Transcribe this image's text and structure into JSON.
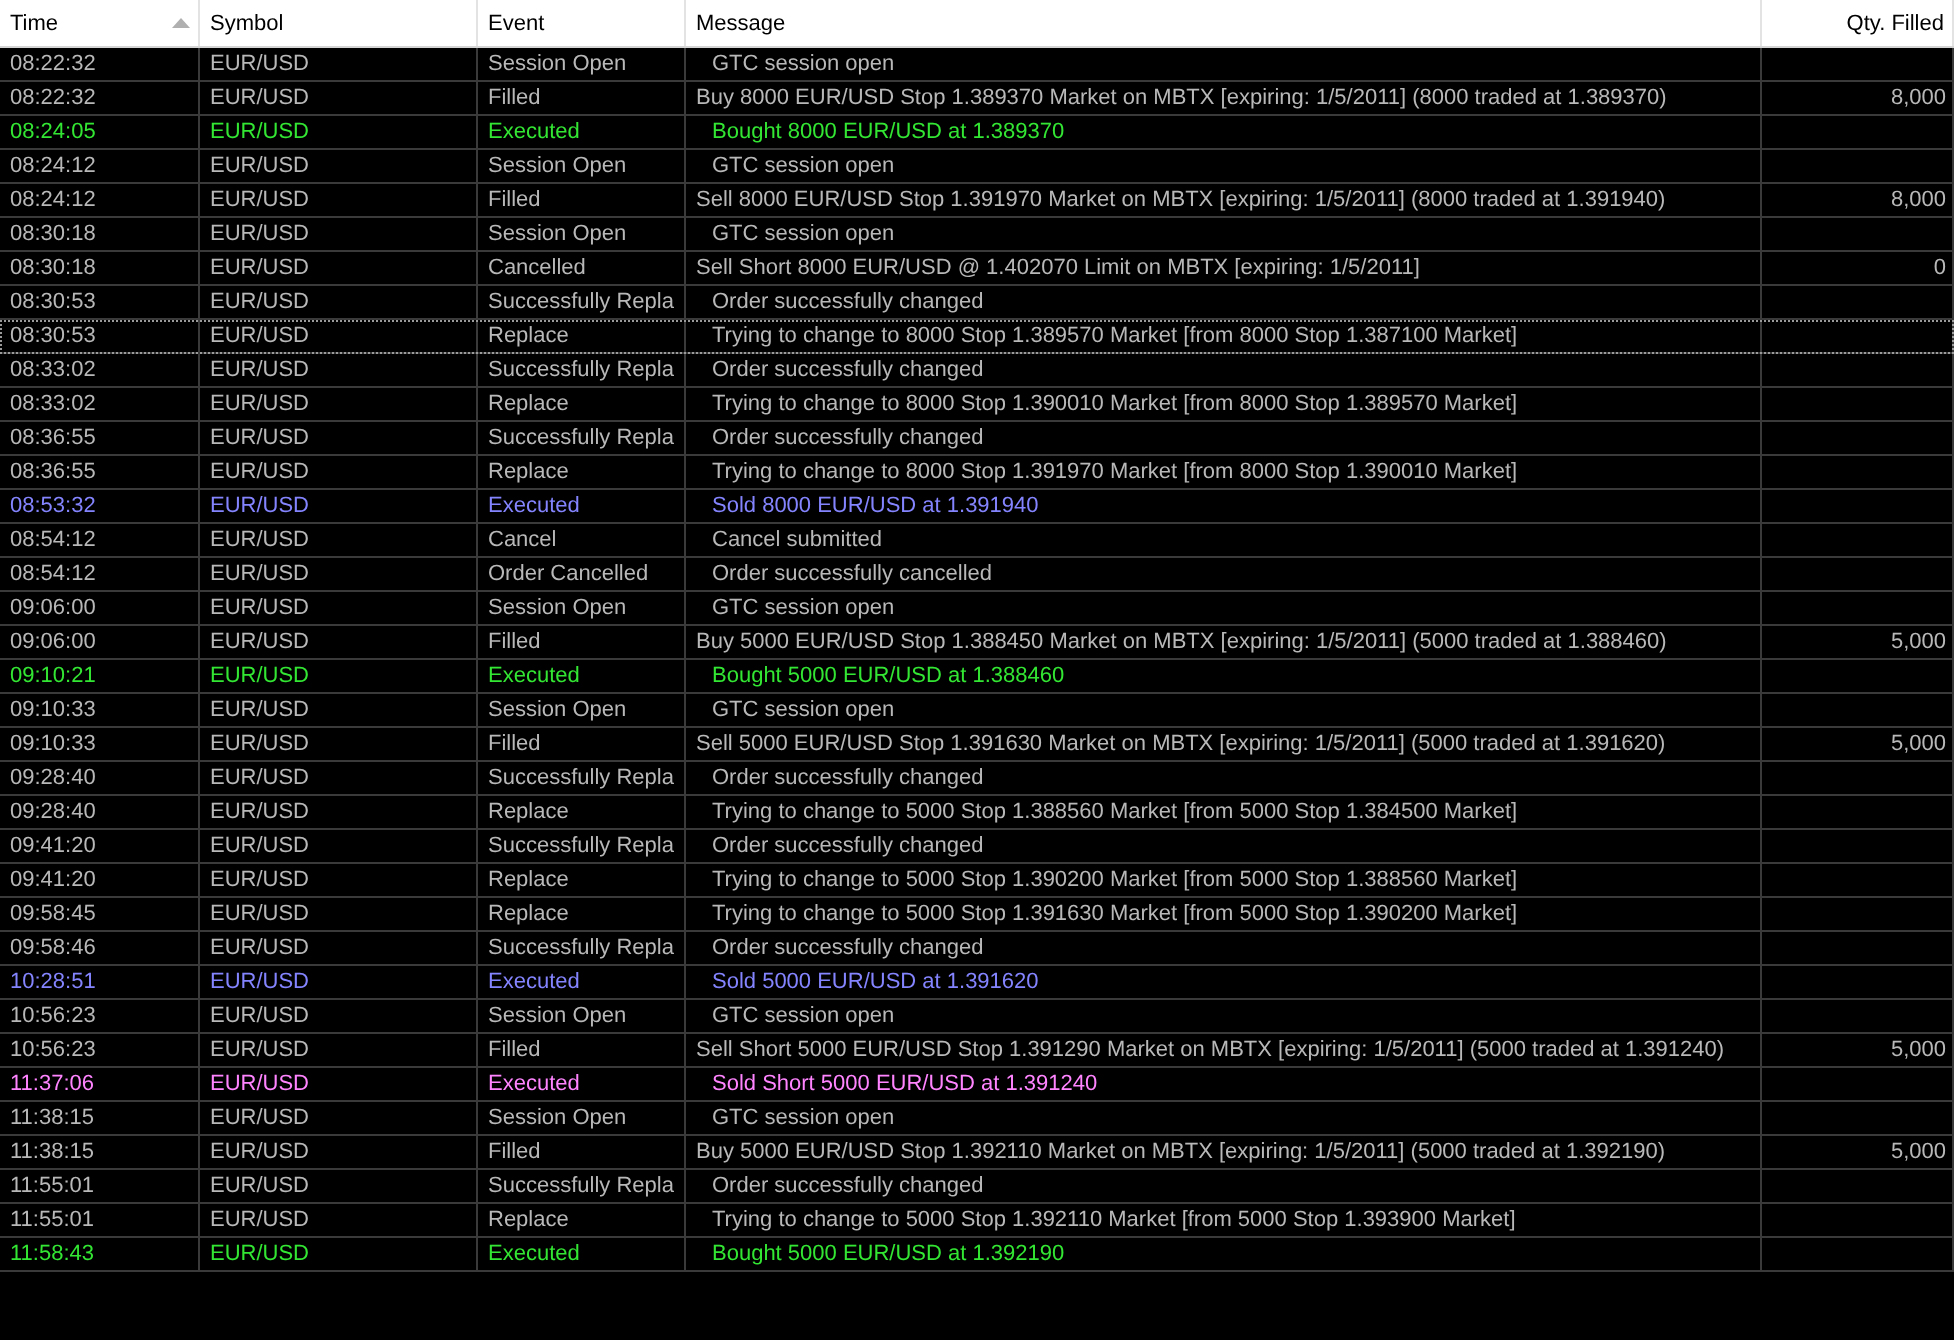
{
  "table": {
    "columns": [
      {
        "label": "Time",
        "sorted": true
      },
      {
        "label": "Symbol",
        "sorted": false
      },
      {
        "label": "Event",
        "sorted": false
      },
      {
        "label": "Message",
        "sorted": false
      },
      {
        "label": "Qty. Filled",
        "sorted": false
      }
    ],
    "rows": [
      {
        "time": "08:22:32",
        "symbol": "EUR/USD",
        "event": "Session Open",
        "message": "GTC session open",
        "indented": true,
        "qty": "",
        "kind": "info",
        "focused": false
      },
      {
        "time": "08:22:32",
        "symbol": "EUR/USD",
        "event": "Filled",
        "message": "Buy 8000 EUR/USD Stop 1.389370 Market on MBTX [expiring: 1/5/2011] (8000 traded at 1.389370)",
        "indented": false,
        "qty": "8,000",
        "kind": "info",
        "focused": false
      },
      {
        "time": "08:24:05",
        "symbol": "EUR/USD",
        "event": "Executed",
        "message": "Bought 8000 EUR/USD at 1.389370",
        "indented": true,
        "qty": "",
        "kind": "bought",
        "focused": false
      },
      {
        "time": "08:24:12",
        "symbol": "EUR/USD",
        "event": "Session Open",
        "message": "GTC session open",
        "indented": true,
        "qty": "",
        "kind": "info",
        "focused": false
      },
      {
        "time": "08:24:12",
        "symbol": "EUR/USD",
        "event": "Filled",
        "message": "Sell 8000 EUR/USD Stop 1.391970 Market on MBTX [expiring: 1/5/2011] (8000 traded at 1.391940)",
        "indented": false,
        "qty": "8,000",
        "kind": "info",
        "focused": false
      },
      {
        "time": "08:30:18",
        "symbol": "EUR/USD",
        "event": "Session Open",
        "message": "GTC session open",
        "indented": true,
        "qty": "",
        "kind": "info",
        "focused": false
      },
      {
        "time": "08:30:18",
        "symbol": "EUR/USD",
        "event": "Cancelled",
        "message": "Sell Short 8000 EUR/USD @ 1.402070 Limit on MBTX [expiring: 1/5/2011]",
        "indented": false,
        "qty": "0",
        "kind": "info",
        "focused": false
      },
      {
        "time": "08:30:53",
        "symbol": "EUR/USD",
        "event": "Successfully Repla",
        "message": "Order successfully changed",
        "indented": true,
        "qty": "",
        "kind": "info",
        "focused": false
      },
      {
        "time": "08:30:53",
        "symbol": "EUR/USD",
        "event": "Replace",
        "message": "Trying to change to 8000 Stop 1.389570 Market [from 8000 Stop 1.387100 Market]",
        "indented": true,
        "qty": "",
        "kind": "info",
        "focused": true
      },
      {
        "time": "08:33:02",
        "symbol": "EUR/USD",
        "event": "Successfully Repla",
        "message": "Order successfully changed",
        "indented": true,
        "qty": "",
        "kind": "info",
        "focused": false
      },
      {
        "time": "08:33:02",
        "symbol": "EUR/USD",
        "event": "Replace",
        "message": "Trying to change to 8000 Stop 1.390010 Market [from 8000 Stop 1.389570 Market]",
        "indented": true,
        "qty": "",
        "kind": "info",
        "focused": false
      },
      {
        "time": "08:36:55",
        "symbol": "EUR/USD",
        "event": "Successfully Repla",
        "message": "Order successfully changed",
        "indented": true,
        "qty": "",
        "kind": "info",
        "focused": false
      },
      {
        "time": "08:36:55",
        "symbol": "EUR/USD",
        "event": "Replace",
        "message": "Trying to change to 8000 Stop 1.391970 Market [from 8000 Stop 1.390010 Market]",
        "indented": true,
        "qty": "",
        "kind": "info",
        "focused": false
      },
      {
        "time": "08:53:32",
        "symbol": "EUR/USD",
        "event": "Executed",
        "message": "Sold 8000 EUR/USD at 1.391940",
        "indented": true,
        "qty": "",
        "kind": "sold",
        "focused": false
      },
      {
        "time": "08:54:12",
        "symbol": "EUR/USD",
        "event": "Cancel",
        "message": "Cancel submitted",
        "indented": true,
        "qty": "",
        "kind": "info",
        "focused": false
      },
      {
        "time": "08:54:12",
        "symbol": "EUR/USD",
        "event": "Order Cancelled",
        "message": "Order successfully cancelled",
        "indented": true,
        "qty": "",
        "kind": "info",
        "focused": false
      },
      {
        "time": "09:06:00",
        "symbol": "EUR/USD",
        "event": "Session Open",
        "message": "GTC session open",
        "indented": true,
        "qty": "",
        "kind": "info",
        "focused": false
      },
      {
        "time": "09:06:00",
        "symbol": "EUR/USD",
        "event": "Filled",
        "message": "Buy 5000 EUR/USD Stop 1.388450 Market on MBTX [expiring: 1/5/2011] (5000 traded at 1.388460)",
        "indented": false,
        "qty": "5,000",
        "kind": "info",
        "focused": false
      },
      {
        "time": "09:10:21",
        "symbol": "EUR/USD",
        "event": "Executed",
        "message": "Bought 5000 EUR/USD at 1.388460",
        "indented": true,
        "qty": "",
        "kind": "bought",
        "focused": false
      },
      {
        "time": "09:10:33",
        "symbol": "EUR/USD",
        "event": "Session Open",
        "message": "GTC session open",
        "indented": true,
        "qty": "",
        "kind": "info",
        "focused": false
      },
      {
        "time": "09:10:33",
        "symbol": "EUR/USD",
        "event": "Filled",
        "message": "Sell 5000 EUR/USD Stop 1.391630 Market on MBTX [expiring: 1/5/2011] (5000 traded at 1.391620)",
        "indented": false,
        "qty": "5,000",
        "kind": "info",
        "focused": false
      },
      {
        "time": "09:28:40",
        "symbol": "EUR/USD",
        "event": "Successfully Repla",
        "message": "Order successfully changed",
        "indented": true,
        "qty": "",
        "kind": "info",
        "focused": false
      },
      {
        "time": "09:28:40",
        "symbol": "EUR/USD",
        "event": "Replace",
        "message": "Trying to change to 5000 Stop 1.388560 Market [from 5000 Stop 1.384500 Market]",
        "indented": true,
        "qty": "",
        "kind": "info",
        "focused": false
      },
      {
        "time": "09:41:20",
        "symbol": "EUR/USD",
        "event": "Successfully Repla",
        "message": "Order successfully changed",
        "indented": true,
        "qty": "",
        "kind": "info",
        "focused": false
      },
      {
        "time": "09:41:20",
        "symbol": "EUR/USD",
        "event": "Replace",
        "message": "Trying to change to 5000 Stop 1.390200 Market [from 5000 Stop 1.388560 Market]",
        "indented": true,
        "qty": "",
        "kind": "info",
        "focused": false
      },
      {
        "time": "09:58:45",
        "symbol": "EUR/USD",
        "event": "Replace",
        "message": "Trying to change to 5000 Stop 1.391630 Market [from 5000 Stop 1.390200 Market]",
        "indented": true,
        "qty": "",
        "kind": "info",
        "focused": false
      },
      {
        "time": "09:58:46",
        "symbol": "EUR/USD",
        "event": "Successfully Repla",
        "message": "Order successfully changed",
        "indented": true,
        "qty": "",
        "kind": "info",
        "focused": false
      },
      {
        "time": "10:28:51",
        "symbol": "EUR/USD",
        "event": "Executed",
        "message": "Sold 5000 EUR/USD at 1.391620",
        "indented": true,
        "qty": "",
        "kind": "sold",
        "focused": false
      },
      {
        "time": "10:56:23",
        "symbol": "EUR/USD",
        "event": "Session Open",
        "message": "GTC session open",
        "indented": true,
        "qty": "",
        "kind": "info",
        "focused": false
      },
      {
        "time": "10:56:23",
        "symbol": "EUR/USD",
        "event": "Filled",
        "message": "Sell Short 5000 EUR/USD Stop 1.391290 Market on MBTX [expiring: 1/5/2011] (5000 traded at 1.391240)",
        "indented": false,
        "qty": "5,000",
        "kind": "info",
        "focused": false
      },
      {
        "time": "11:37:06",
        "symbol": "EUR/USD",
        "event": "Executed",
        "message": "Sold Short 5000 EUR/USD at 1.391240",
        "indented": true,
        "qty": "",
        "kind": "sold_short",
        "focused": false
      },
      {
        "time": "11:38:15",
        "symbol": "EUR/USD",
        "event": "Session Open",
        "message": "GTC session open",
        "indented": true,
        "qty": "",
        "kind": "info",
        "focused": false
      },
      {
        "time": "11:38:15",
        "symbol": "EUR/USD",
        "event": "Filled",
        "message": "Buy 5000 EUR/USD Stop 1.392110 Market on MBTX [expiring: 1/5/2011] (5000 traded at 1.392190)",
        "indented": false,
        "qty": "5,000",
        "kind": "info",
        "focused": false
      },
      {
        "time": "11:55:01",
        "symbol": "EUR/USD",
        "event": "Successfully Repla",
        "message": "Order successfully changed",
        "indented": true,
        "qty": "",
        "kind": "info",
        "focused": false
      },
      {
        "time": "11:55:01",
        "symbol": "EUR/USD",
        "event": "Replace",
        "message": "Trying to change to 5000 Stop 1.392110 Market [from 5000 Stop 1.393900 Market]",
        "indented": true,
        "qty": "",
        "kind": "info",
        "focused": false
      },
      {
        "time": "11:58:43",
        "symbol": "EUR/USD",
        "event": "Executed",
        "message": "Bought 5000 EUR/USD at 1.392190",
        "indented": true,
        "qty": "",
        "kind": "bought",
        "focused": false
      }
    ]
  }
}
